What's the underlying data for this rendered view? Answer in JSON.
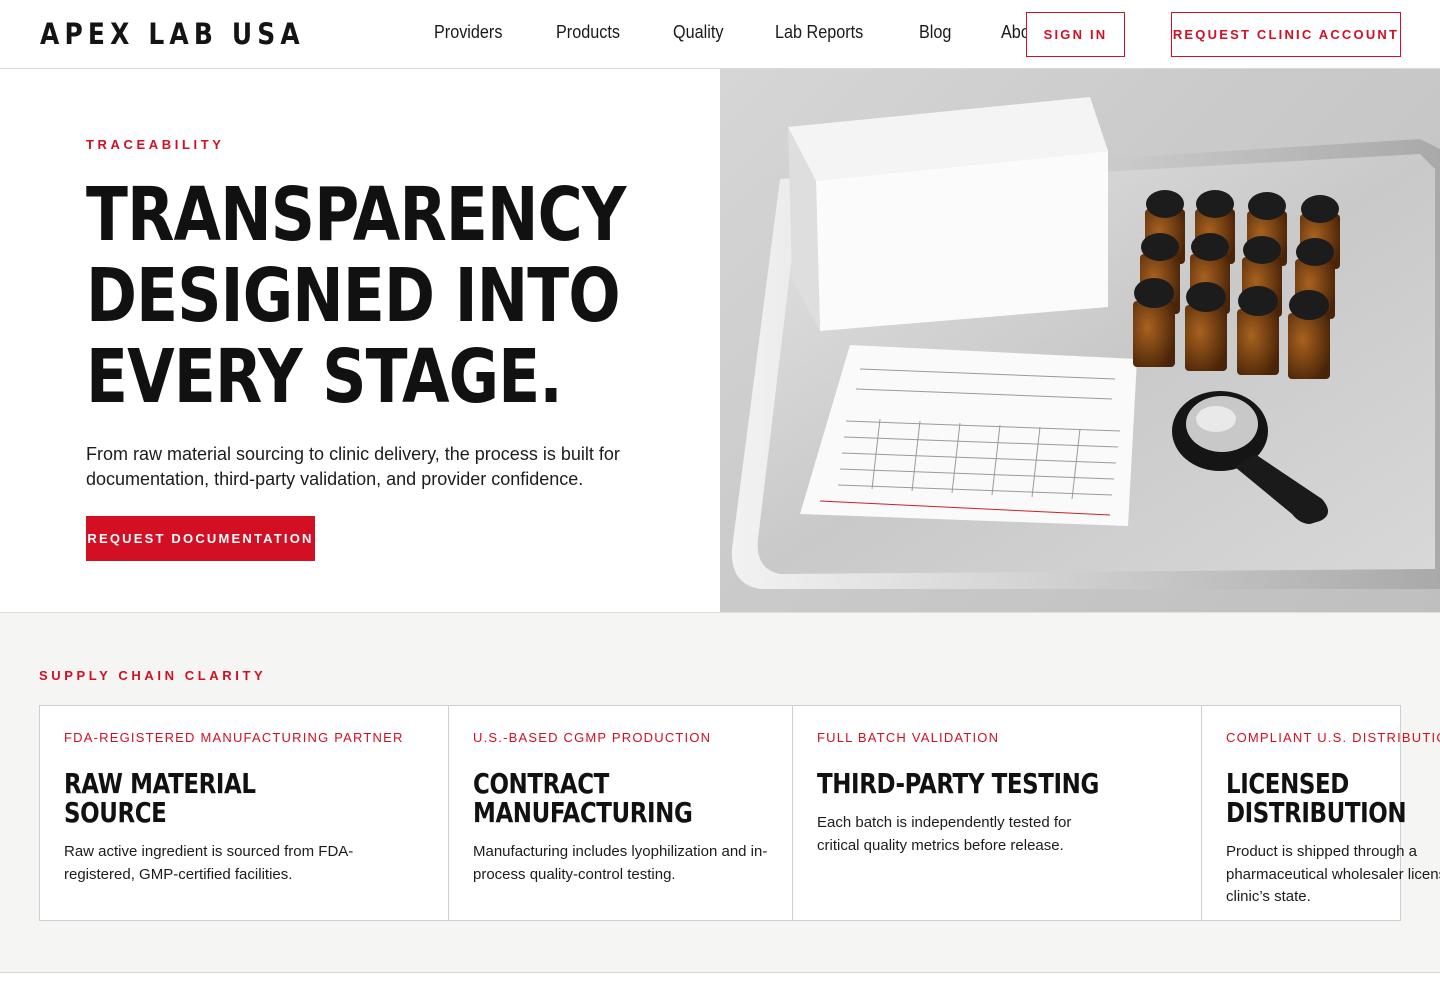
{
  "header": {
    "logo": "APEX LAB USA",
    "nav": [
      "Providers",
      "Products",
      "Quality",
      "Lab Reports",
      "Blog",
      "About"
    ],
    "sign_in": "SIGN IN",
    "request_account": "REQUEST CLINIC ACCOUNT"
  },
  "hero": {
    "eyebrow": "TRACEABILITY",
    "title_lines": [
      "TRANSPARENCY",
      "DESIGNED INTO",
      "EVERY STAGE."
    ],
    "subtitle": "From raw material sourcing to clinic delivery, the process is built for documentation, third-party validation, and provider confidence.",
    "cta": "REQUEST DOCUMENTATION"
  },
  "supply_chain": {
    "eyebrow": "SUPPLY CHAIN CLARITY",
    "cards": [
      {
        "tag": "FDA-REGISTERED MANUFACTURING PARTNER",
        "title": "RAW MATERIAL SOURCE",
        "body": "Raw active ingredient is sourced from FDA-registered, GMP-certified facilities."
      },
      {
        "tag": "U.S.-BASED CGMP PRODUCTION",
        "title": "CONTRACT MANUFACTURING",
        "body": "Manufacturing includes lyophilization and in-process quality-control testing."
      },
      {
        "tag": "FULL BATCH VALIDATION",
        "title": "THIRD-PARTY TESTING",
        "body": "Each batch is independently tested for critical quality metrics before release."
      },
      {
        "tag": "COMPLIANT U.S. DISTRIBUTION",
        "title": "LICENSED DISTRIBUTION",
        "body": "Product is shipped through a pharmaceutical wholesaler licensed in the clinic’s state."
      }
    ]
  },
  "colors": {
    "accent": "#d20f23",
    "text": "#111111",
    "section_bg": "#f5f5f3"
  }
}
